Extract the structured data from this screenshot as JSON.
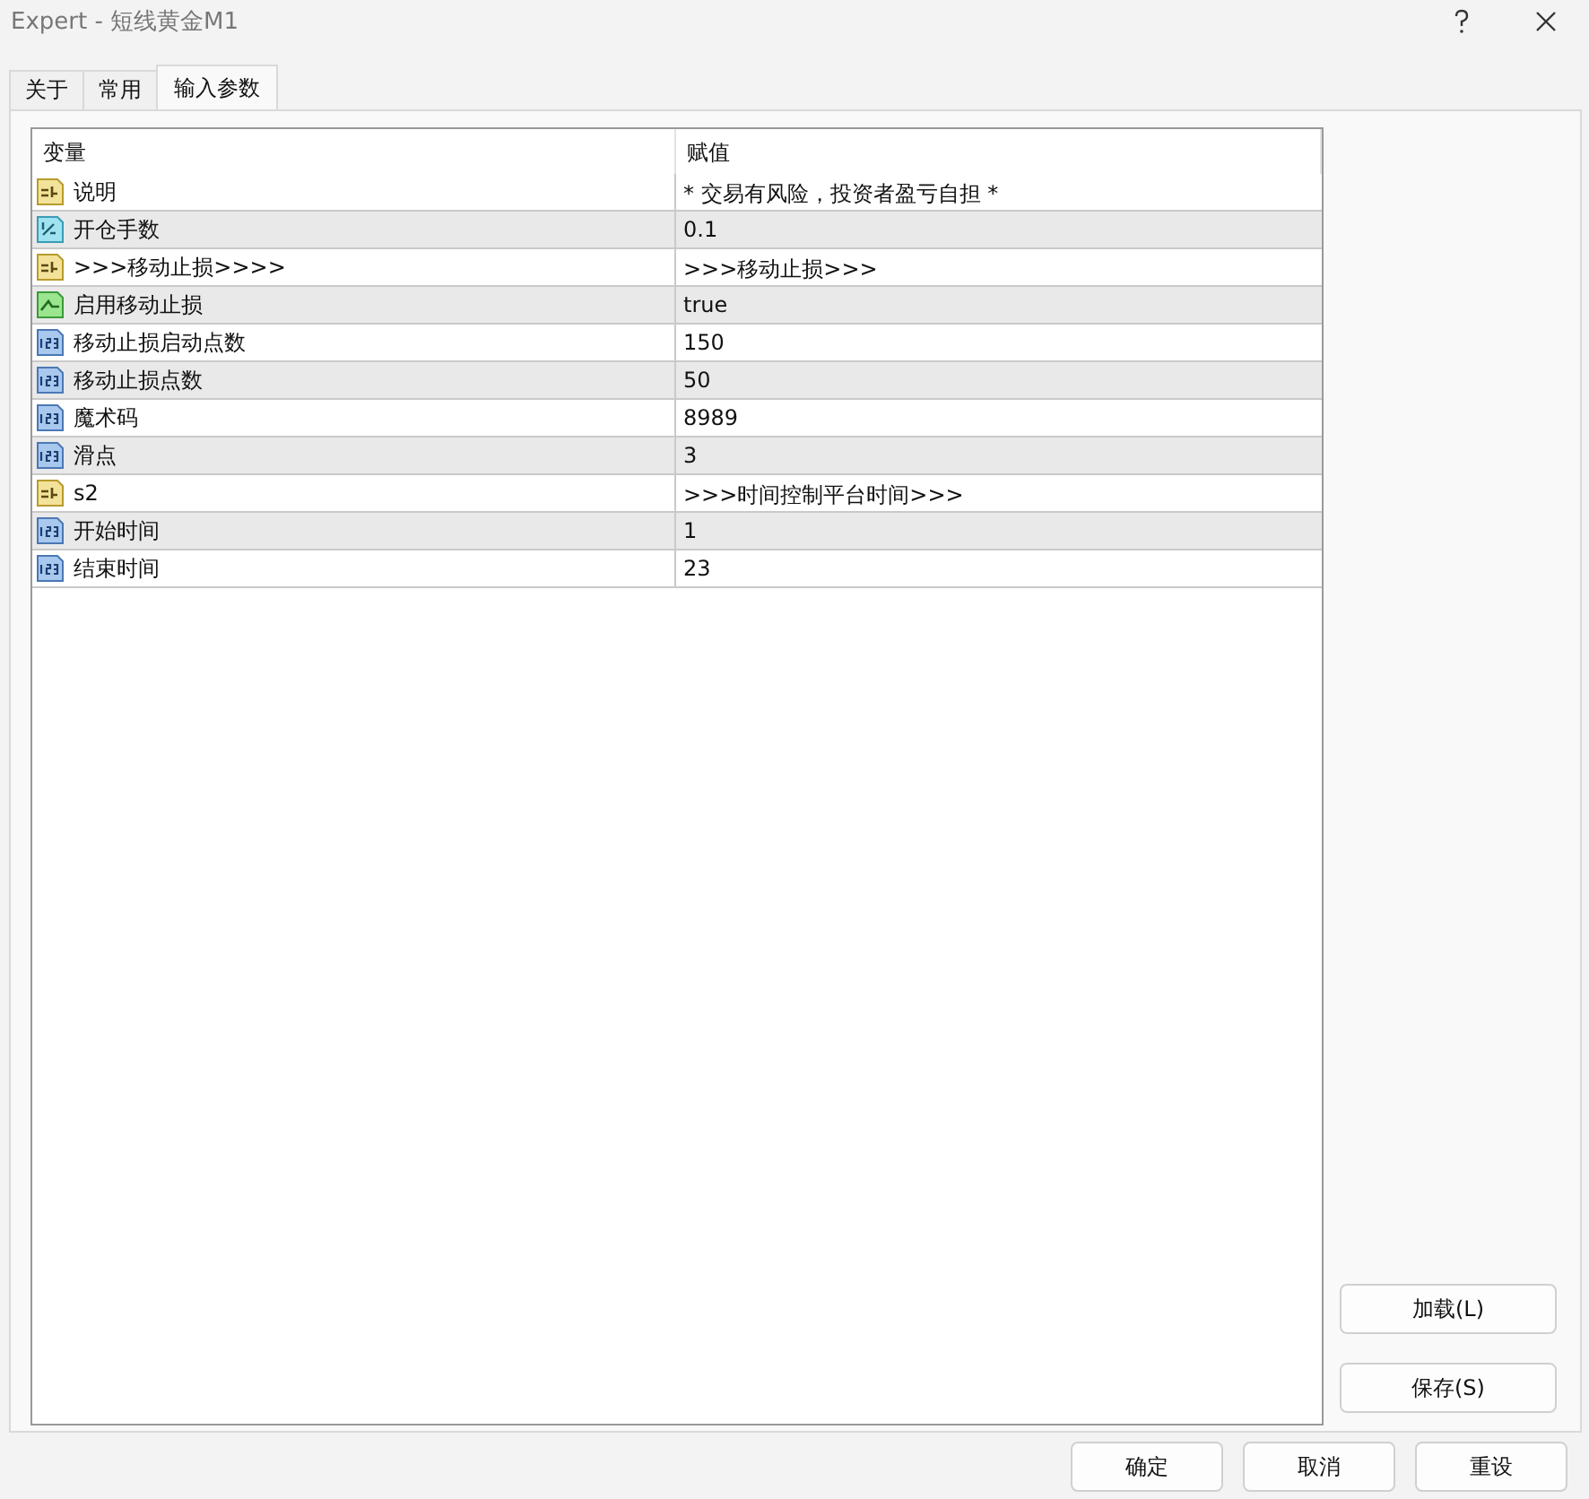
{
  "window": {
    "title": "Expert - 短线黄金M1"
  },
  "tabs": [
    {
      "label": "关于",
      "selected": false
    },
    {
      "label": "常用",
      "selected": false
    },
    {
      "label": "输入参数",
      "selected": true
    }
  ],
  "table": {
    "columns": [
      "变量",
      "赋值"
    ],
    "rows": [
      {
        "kind": "string",
        "name": "说明",
        "value": "* 交易有风险，投资者盈亏自担 *"
      },
      {
        "kind": "double",
        "name": "开仓手数",
        "value": "0.1"
      },
      {
        "kind": "string",
        "name": ">>>移动止损>>>>",
        "value": ">>>移动止损>>>"
      },
      {
        "kind": "bool",
        "name": "启用移动止损",
        "value": "true"
      },
      {
        "kind": "int",
        "name": "移动止损启动点数",
        "value": "150"
      },
      {
        "kind": "int",
        "name": "移动止损点数",
        "value": "50"
      },
      {
        "kind": "int",
        "name": "魔术码",
        "value": "8989"
      },
      {
        "kind": "int",
        "name": "滑点",
        "value": "3"
      },
      {
        "kind": "string",
        "name": "s2",
        "value": ">>>时间控制平台时间>>>"
      },
      {
        "kind": "int",
        "name": "开始时间",
        "value": "1"
      },
      {
        "kind": "int",
        "name": "结束时间",
        "value": "23"
      }
    ]
  },
  "side_buttons": [
    "加载(L)",
    "保存(S)"
  ],
  "buttons": [
    "确定",
    "取消",
    "重设"
  ]
}
